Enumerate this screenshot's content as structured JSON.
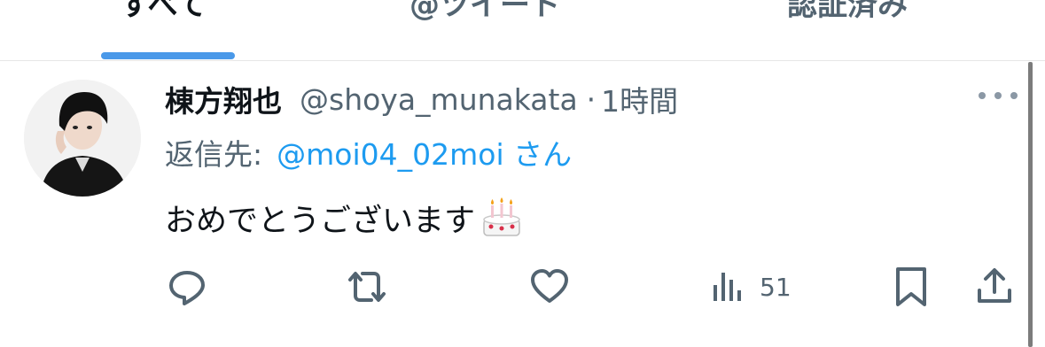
{
  "tabs": [
    {
      "label": "すべて",
      "active": true
    },
    {
      "label": "@ツイート",
      "active": false
    },
    {
      "label": "認証済み",
      "active": false
    }
  ],
  "tweet": {
    "author_name": "棟方翔也",
    "handle": "@shoya_munakata",
    "separator": "·",
    "time": "1時間",
    "reply_label": "返信先:",
    "reply_mention": "@moi04_02moi",
    "reply_suffix": "さん",
    "text": "おめでとうございます",
    "emoji": "birthday-cake",
    "views_count": "51"
  },
  "icons": {
    "reply": "reply-icon",
    "retweet": "retweet-icon",
    "like": "heart-icon",
    "views": "analytics-icon",
    "bookmark": "bookmark-icon",
    "share": "share-icon",
    "more": "more-icon"
  },
  "colors": {
    "accent": "#1d9bf0",
    "tab_indicator": "#4a99e9",
    "secondary_text": "#536471",
    "primary_text": "#0f1419"
  }
}
